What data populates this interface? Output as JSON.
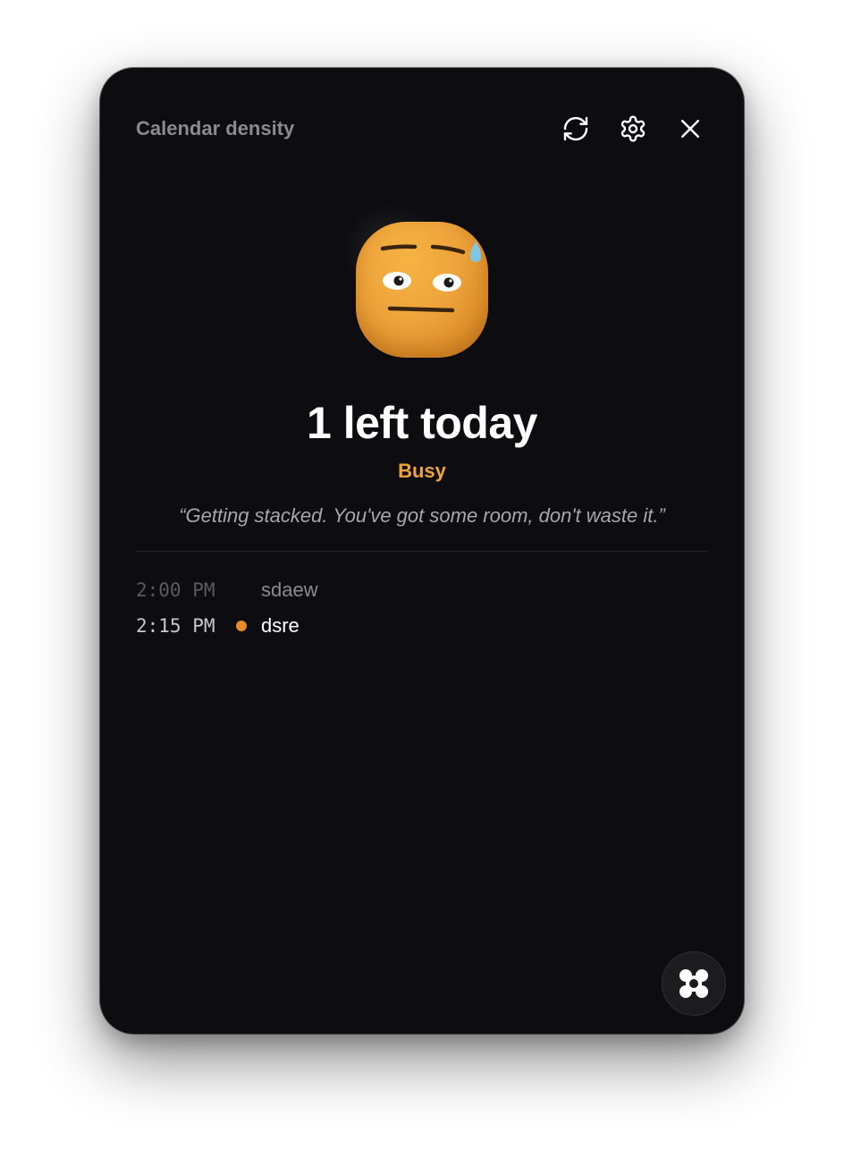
{
  "header": {
    "title": "Calendar density",
    "refresh_icon": "refresh-icon",
    "settings_icon": "gear-icon",
    "close_icon": "close-icon"
  },
  "mood": {
    "emoji": "sweating-face-icon",
    "count_text": "1 left today",
    "status_label": "Busy",
    "status_color": "#f0a33c",
    "quote": "“Getting stacked. You've got some room, don't waste it.”"
  },
  "events": [
    {
      "time": "2:00 PM",
      "name": "sdaew",
      "state": "past"
    },
    {
      "time": "2:15 PM",
      "name": "dsre",
      "state": "current",
      "dot_color": "#e8892a"
    }
  ],
  "fab": {
    "icon": "app-logo-icon"
  },
  "colors": {
    "window_bg": "#0d0d11",
    "accent": "#f0a33c"
  }
}
